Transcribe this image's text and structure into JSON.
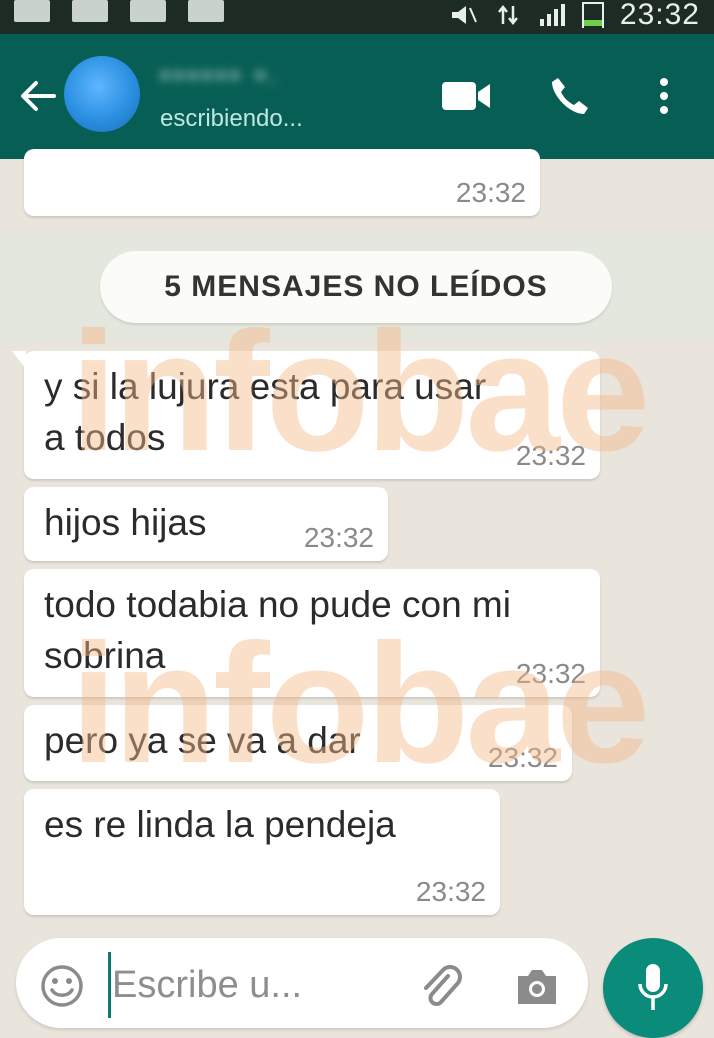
{
  "status_bar": {
    "time": "23:32"
  },
  "header": {
    "contact_name": "▪▪▪▪▪▪ ▪.",
    "contact_status": "escribiendo..."
  },
  "chat": {
    "first_message_time": "23:32",
    "unread_label": "5 MENSAJES NO LEÍDOS",
    "messages": [
      {
        "text": "y si la lujura esta para usar a todos",
        "time": "23:32"
      },
      {
        "text": "hijos hijas",
        "time": "23:32"
      },
      {
        "text": "todo todabia no pude con mi sobrina",
        "time": "23:32"
      },
      {
        "text": "pero ya se va a dar",
        "time": "23:32"
      },
      {
        "text": "es re linda la pendeja",
        "time": "23:32"
      }
    ],
    "watermark": "infobae"
  },
  "composer": {
    "placeholder": "Escribe u..."
  },
  "colors": {
    "header": "#075e54",
    "accent": "#0b8b79",
    "background": "#e9e4dc",
    "watermark": "#f4b98a"
  }
}
